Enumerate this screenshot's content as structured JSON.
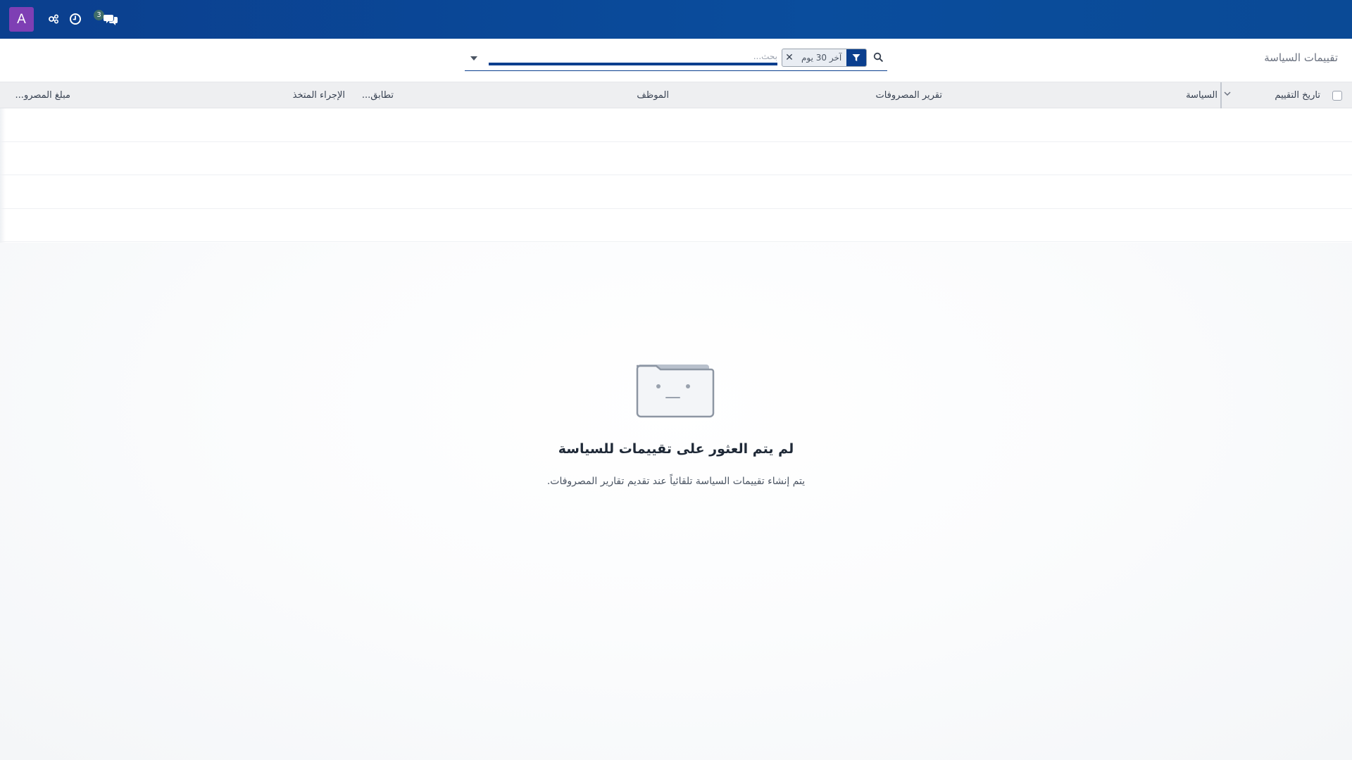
{
  "navbar": {
    "avatar_letter": "A",
    "badge_count": "3",
    "icons": [
      "share-nodes-icon",
      "clock-icon",
      "chat-bubbles-icon"
    ],
    "background": "#0b3f8e",
    "avatar_color": "#7e3fb4"
  },
  "breadcrumb": {
    "title": "تقييمات السياسة"
  },
  "search": {
    "placeholder": "بحث...",
    "facet_value": "آخر 30 يوم",
    "facet_remove": "✕"
  },
  "table": {
    "headers": {
      "evaluation_date": "تاريخ التقييم",
      "policy": "السياسة",
      "expense_report": "تقرير المصروفات",
      "employee": "الموظف",
      "compliance": "تطابق...",
      "action_taken": "الإجراء المتخذ",
      "expense_amount": "مبلغ المصرو..."
    }
  },
  "empty_state": {
    "title": "لم يتم العثور على تقييمات للسياسة",
    "subtitle": "يتم إنشاء تقييمات السياسة تلقائياً عند تقديم تقارير المصروفات."
  }
}
